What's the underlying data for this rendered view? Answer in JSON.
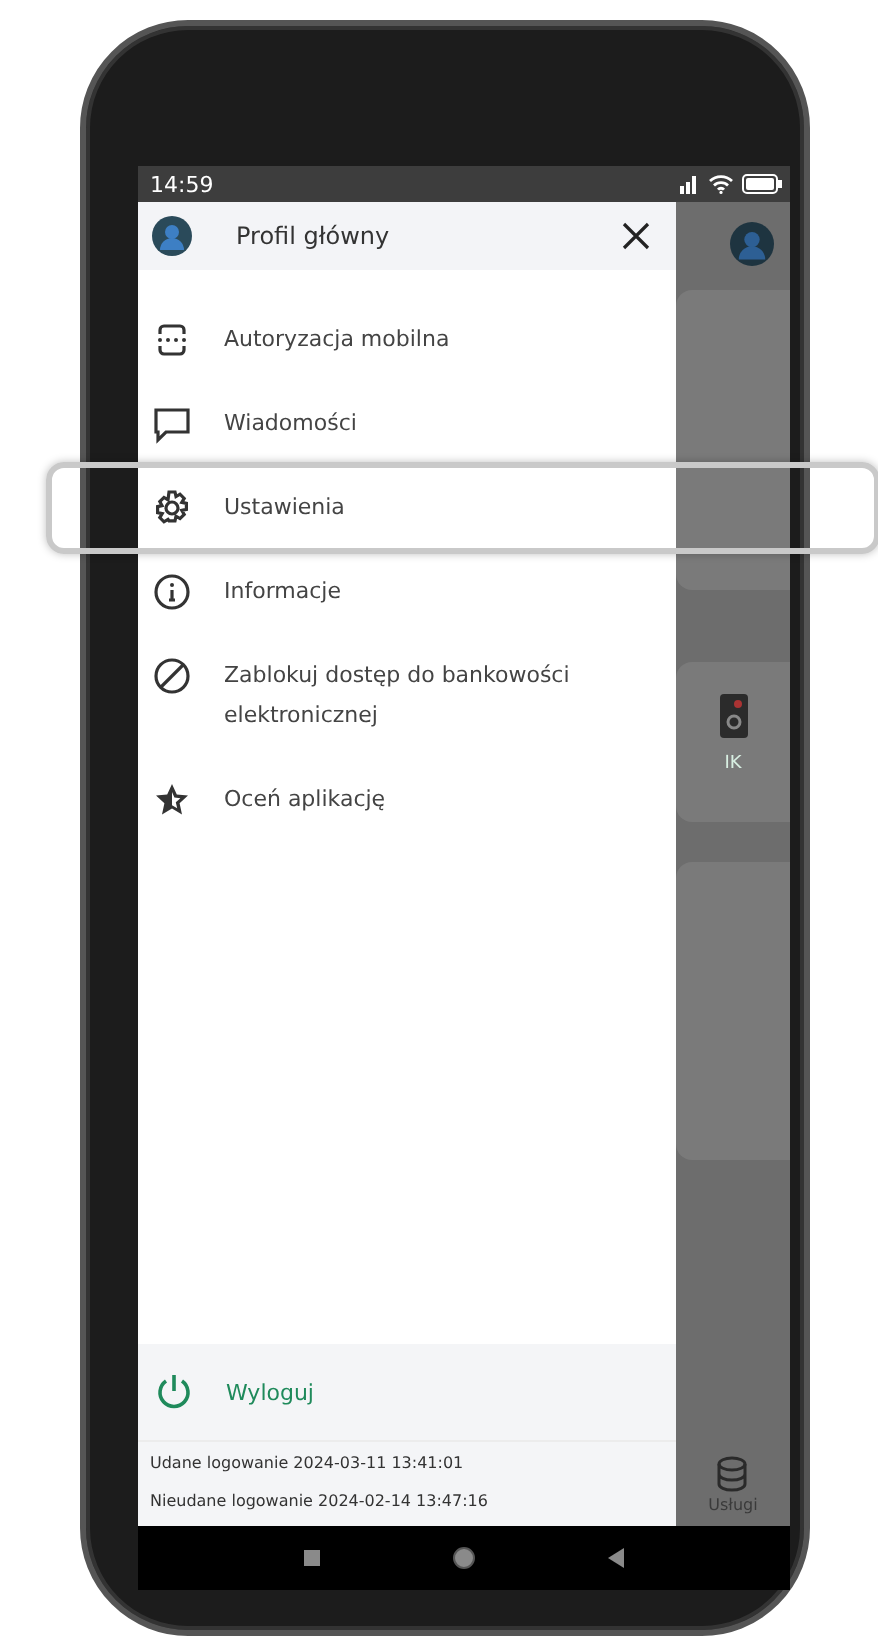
{
  "status_bar": {
    "time": "14:59"
  },
  "drawer": {
    "title": "Profil główny",
    "items": [
      {
        "kind": "keypad",
        "label": "Autoryzacja mobilna",
        "highlighted": false
      },
      {
        "kind": "message",
        "label": "Wiadomości",
        "highlighted": false
      },
      {
        "kind": "gear",
        "label": "Ustawienia",
        "highlighted": true
      },
      {
        "kind": "info",
        "label": "Informacje",
        "highlighted": false
      },
      {
        "kind": "block",
        "label": "Zablokuj dostęp do bankowości elektronicznej",
        "highlighted": false
      },
      {
        "kind": "star",
        "label": "Oceń aplikację",
        "highlighted": false
      }
    ],
    "logout": "Wyloguj",
    "login_info": [
      "Udane logowanie 2024-03-11 13:41:01",
      "Nieudane logowanie 2024-02-14 13:47:16"
    ]
  },
  "background": {
    "tile_label": "IK",
    "nav_label": "Usługi"
  }
}
